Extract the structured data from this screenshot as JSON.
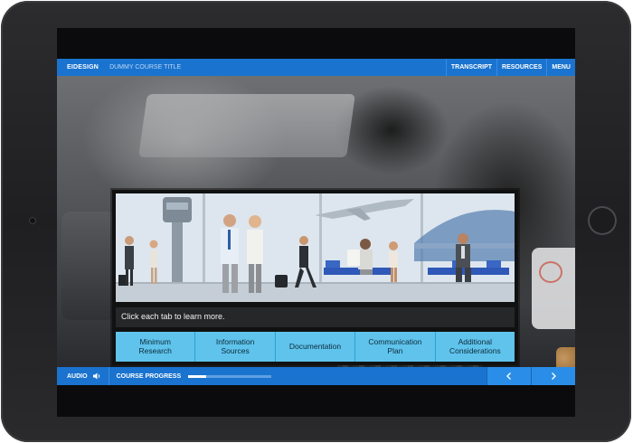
{
  "topbar": {
    "brand": "EIDESIGN",
    "course_title": "DUMMY COURSE TITLE",
    "transcript_label": "TRANSCRIPT",
    "resources_label": "RESOURCES",
    "menu_label": "MENU"
  },
  "content": {
    "instruction": "Click each tab to learn more.",
    "tabs": [
      {
        "label": "Minimum\nResearch"
      },
      {
        "label": "Information\nSources"
      },
      {
        "label": "Documentation"
      },
      {
        "label": "Communication\nPlan"
      },
      {
        "label": "Additional\nConsiderations"
      }
    ]
  },
  "bottombar": {
    "audio_label": "AUDIO",
    "progress_label": "COURSE PROGRESS",
    "progress_fraction": 0.22,
    "prev_icon": "chevron-left-icon",
    "next_icon": "chevron-right-icon"
  },
  "colors": {
    "accent": "#1a73cf",
    "tab": "#5fc3ec"
  }
}
